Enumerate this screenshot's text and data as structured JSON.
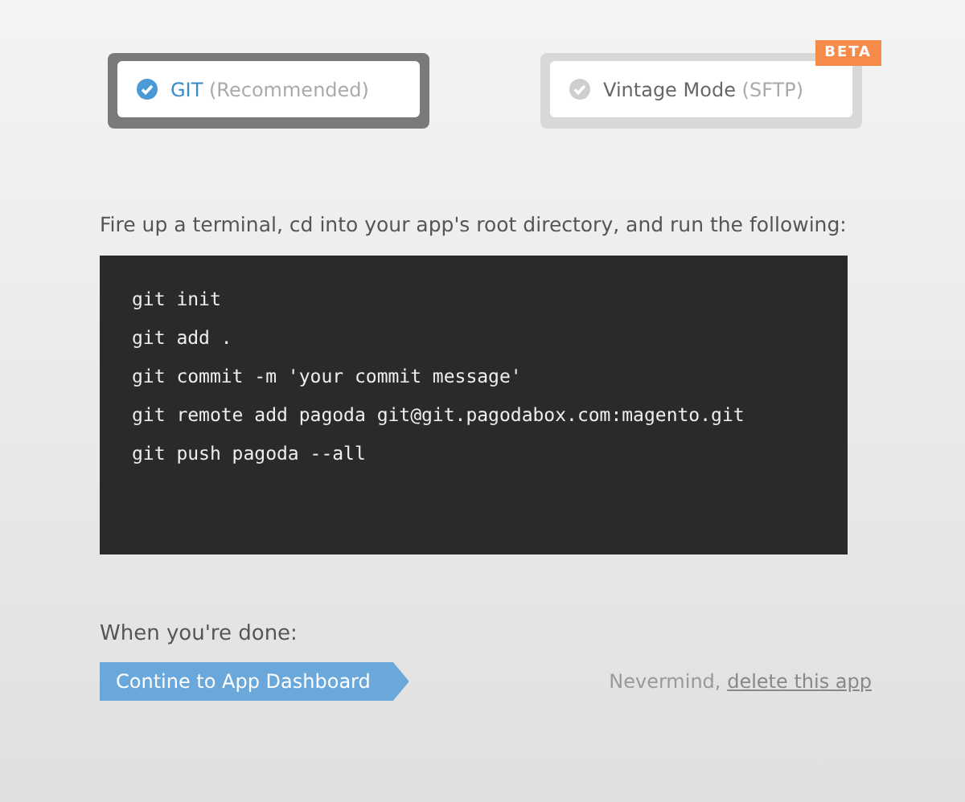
{
  "options": [
    {
      "name": "GIT",
      "note": "(Recommended)",
      "selected": true
    },
    {
      "name": "Vintage Mode",
      "note": "(SFTP)",
      "selected": false,
      "badge": "BETA"
    }
  ],
  "instruction": "Fire up a terminal, cd into your app's root directory, and run the following:",
  "code_lines": [
    "git init",
    "git add .",
    "git commit -m 'your commit message'",
    "git remote add pagoda git@git.pagodabox.com:magento.git",
    "git push pagoda --all"
  ],
  "done_label": "When you're done:",
  "continue_button": "Contine to App Dashboard",
  "cancel": {
    "text": "Nevermind,",
    "link": "delete this app"
  }
}
